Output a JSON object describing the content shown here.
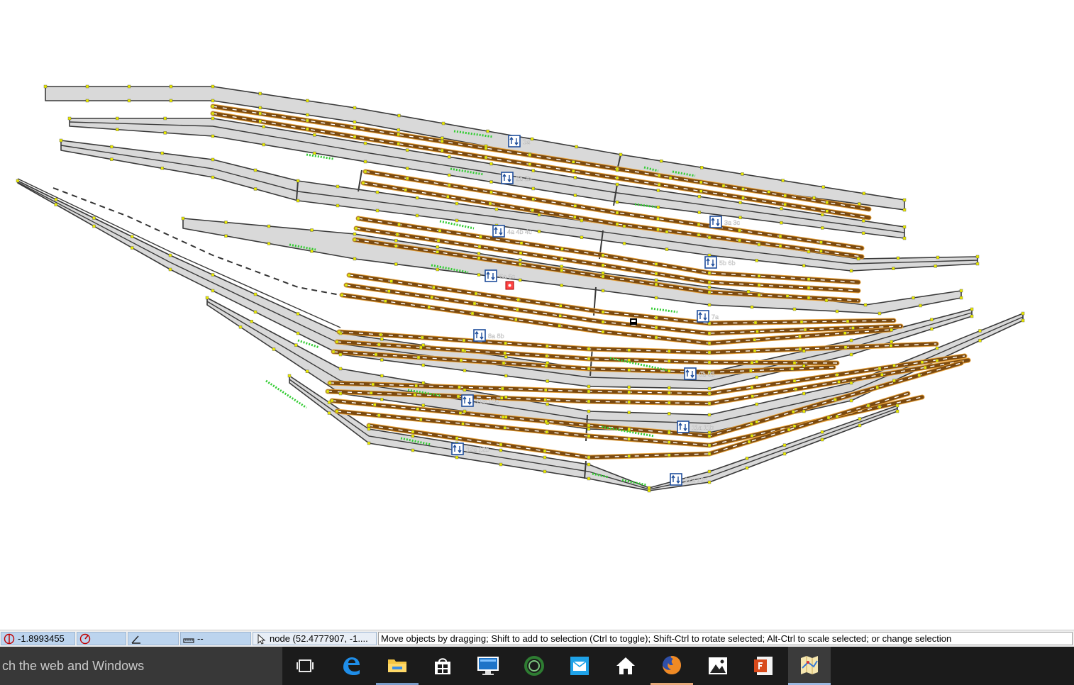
{
  "status_bar": {
    "longitude": "-1.8993455",
    "heading": "",
    "angle": "",
    "distance": "--",
    "selection": "node (52.4777907, -1....",
    "message": "Move objects by dragging; Shift to add to selection (Ctrl to toggle); Shift-Ctrl to rotate selected; Alt-Ctrl to scale selected; or change selection"
  },
  "taskbar": {
    "search_text": "ch the web and Windows",
    "apps": [
      {
        "name": "task-view",
        "label": "Task View"
      },
      {
        "name": "edge",
        "label": "Microsoft Edge"
      },
      {
        "name": "file-explorer",
        "label": "File Explorer"
      },
      {
        "name": "store",
        "label": "Store"
      },
      {
        "name": "lenovo-support",
        "label": "Lenovo"
      },
      {
        "name": "green-app",
        "label": "App"
      },
      {
        "name": "mail",
        "label": "Mail"
      },
      {
        "name": "home",
        "label": "Home"
      },
      {
        "name": "firefox",
        "label": "Firefox"
      },
      {
        "name": "photos",
        "label": "Photos"
      },
      {
        "name": "presentation",
        "label": "Presentation"
      },
      {
        "name": "josm",
        "label": "JOSM"
      }
    ]
  },
  "map": {
    "platform_color": "#d9d9d9",
    "outline_color": "#3a3a3a",
    "rail_color": "#7b4a10",
    "rail_casing": "#e8a23b",
    "node_color": "#e9e900",
    "accent_green": "#33cc33",
    "selected_color": "#ff4444",
    "platform_labels": [
      "1a",
      "2a 2b",
      "3a 3c",
      "4a 4b 4c",
      "5b 6b",
      "6a 6c",
      "7a",
      "8a 8b",
      "9a 9b",
      "10a 10c",
      "11a 11b",
      "12a 12b",
      "12a 12c"
    ]
  }
}
